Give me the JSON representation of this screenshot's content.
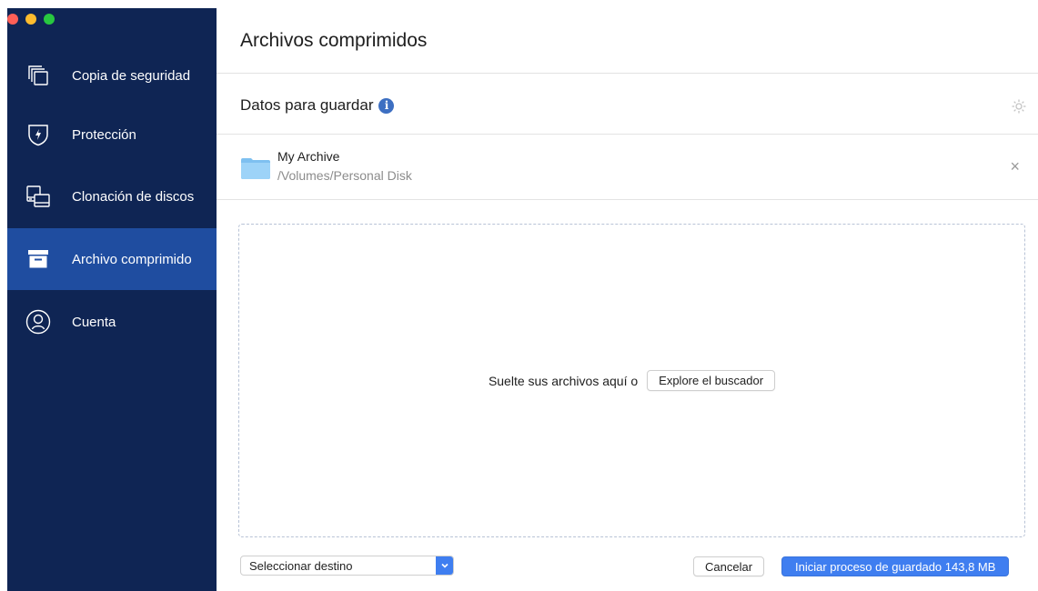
{
  "sidebar": {
    "items": [
      {
        "label": "Copia de seguridad",
        "icon": "backup-copies-icon"
      },
      {
        "label": "Protección",
        "icon": "shield-bolt-icon"
      },
      {
        "label": "Clonación de discos",
        "icon": "disk-clone-icon"
      },
      {
        "label": "Archivo comprimido",
        "icon": "archive-box-icon",
        "active": true
      },
      {
        "label": "Cuenta",
        "icon": "account-icon"
      }
    ]
  },
  "main": {
    "title": "Archivos comprimidos",
    "section_title": "Datos para guardar",
    "item": {
      "name": "My Archive",
      "path": "/Volumes/Personal Disk"
    },
    "dropzone": {
      "text": "Suelte sus archivos aquí o",
      "browse_label": "Explore el buscador"
    },
    "footer": {
      "destination_value": "Seleccionar destino",
      "cancel_label": "Cancelar",
      "start_label": "Iniciar proceso de guardado 143,8 MB"
    }
  },
  "colors": {
    "sidebar_bg": "#0f2554",
    "sidebar_active": "#1f4da0",
    "accent": "#3f7ef0"
  }
}
